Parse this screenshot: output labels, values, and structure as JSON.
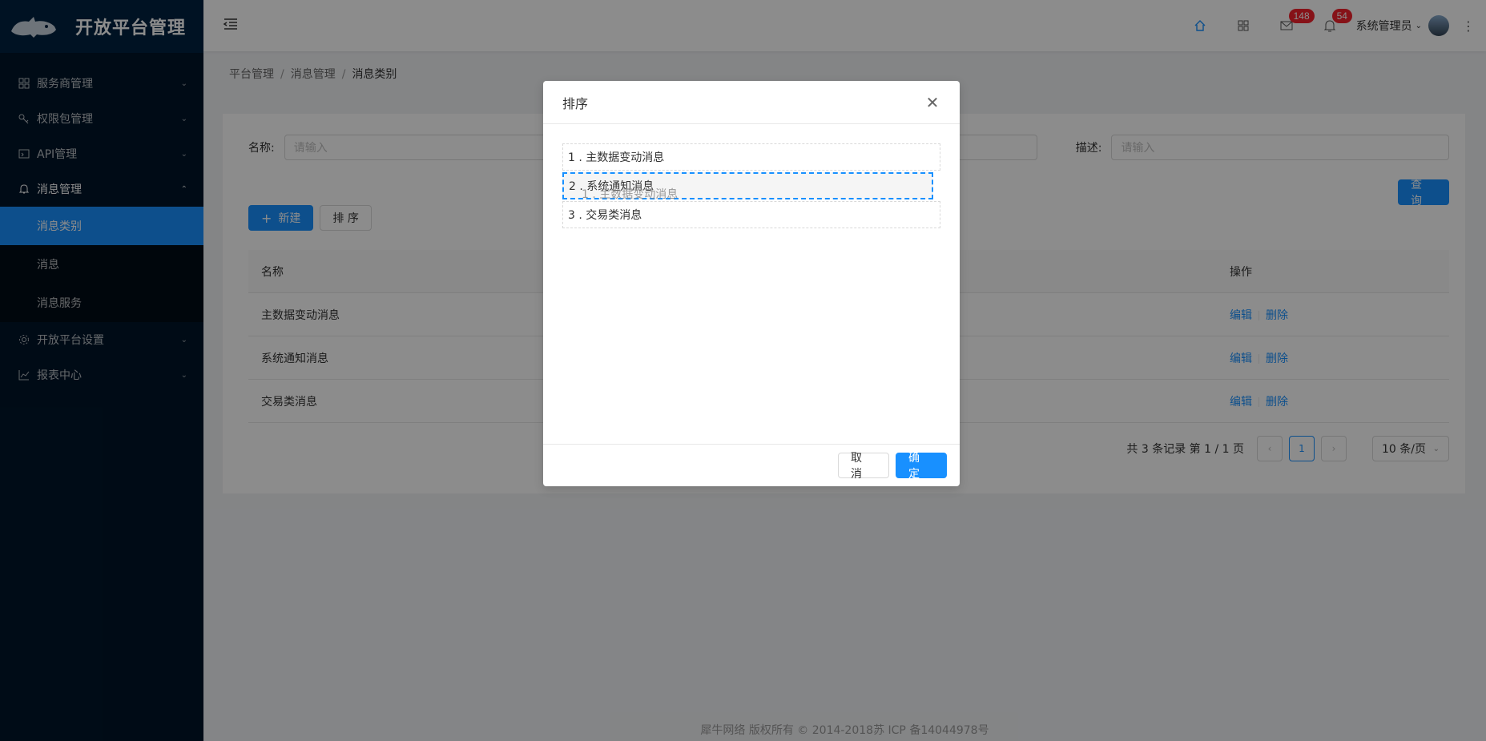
{
  "app": {
    "title": "开放平台管理"
  },
  "sidebar": {
    "items": [
      {
        "label": "服务商管理",
        "icon": "apps-icon",
        "arrow": "⌄"
      },
      {
        "label": "权限包管理",
        "icon": "key-icon",
        "arrow": "⌄"
      },
      {
        "label": "API管理",
        "icon": "code-icon",
        "arrow": "⌄"
      },
      {
        "label": "消息管理",
        "icon": "bell-icon",
        "arrow": "⌃"
      },
      {
        "label": "开放平台设置",
        "icon": "gear-icon",
        "arrow": "⌄"
      },
      {
        "label": "报表中心",
        "icon": "chart-icon",
        "arrow": "⌄"
      }
    ],
    "submenu": [
      "消息类别",
      "消息",
      "消息服务"
    ]
  },
  "header": {
    "mail_badge": "148",
    "notify_badge": "54",
    "user_name": "系统管理员"
  },
  "breadcrumb": [
    "平台管理",
    "消息管理",
    "消息类别"
  ],
  "filters": {
    "name_label": "名称:",
    "name_placeholder": "请输入",
    "desc_label": "描述:",
    "desc_placeholder": "请输入",
    "query_label": "查 询"
  },
  "actions": {
    "new_label": "新建",
    "sort_label": "排 序"
  },
  "table": {
    "columns": [
      "名称",
      "操作"
    ],
    "rows": [
      "主数据变动消息",
      "系统通知消息",
      "交易类消息"
    ],
    "edit_label": "编辑",
    "delete_label": "删除"
  },
  "pagination": {
    "summary": "共 3 条记录 第 1 / 1 页",
    "current": "1",
    "page_size": "10 条/页"
  },
  "footer": {
    "text": "犀牛网络 版权所有 © 2014-2018苏 ICP 备14044978号"
  },
  "modal": {
    "title": "排序",
    "items": [
      "1 . 主数据变动消息",
      "2 . 系统通知消息",
      "3 . 交易类消息"
    ],
    "ghost_text": "1 . 主数据变动消息",
    "cancel_label": "取 消",
    "ok_label": "确 定"
  },
  "colors": {
    "primary": "#1890ff",
    "sidebar_bg": "#001529",
    "badge": "#f5222d"
  }
}
